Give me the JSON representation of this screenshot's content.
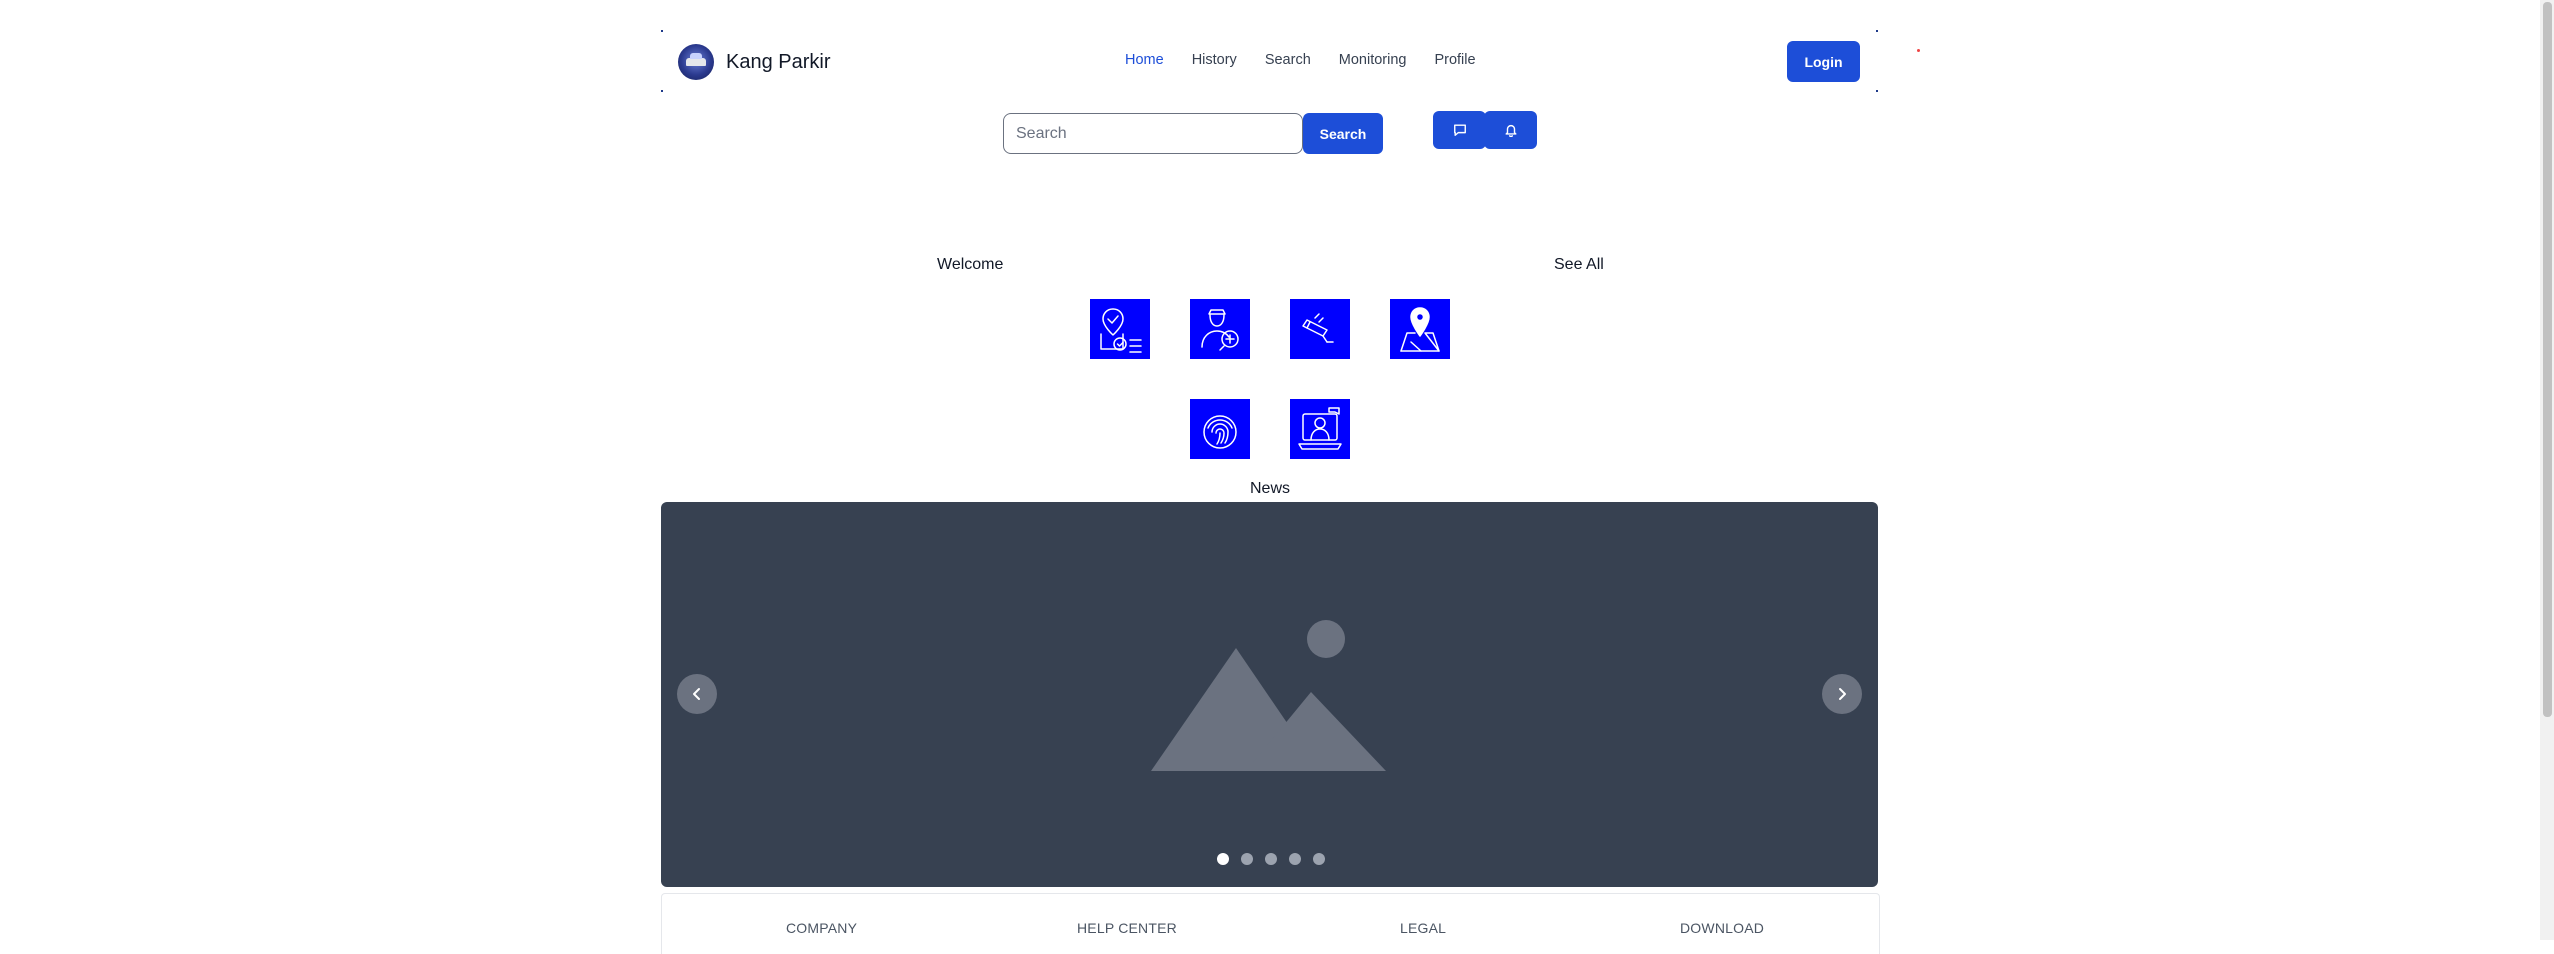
{
  "brand": {
    "name": "Kang Parkir",
    "logo_icon": "car-logo"
  },
  "nav": {
    "items": [
      {
        "label": "Home",
        "active": true
      },
      {
        "label": "History",
        "active": false
      },
      {
        "label": "Search",
        "active": false
      },
      {
        "label": "Monitoring",
        "active": false
      },
      {
        "label": "Profile",
        "active": false
      }
    ],
    "login_label": "Login"
  },
  "search": {
    "placeholder": "Search",
    "value": "",
    "button_label": "Search",
    "icon_buttons": [
      "chat-icon",
      "bell-icon"
    ]
  },
  "welcome": {
    "title": "Welcome",
    "see_all_label": "See All",
    "features": [
      {
        "icon": "location-checklist-icon"
      },
      {
        "icon": "parking-attendant-icon"
      },
      {
        "icon": "cctv-camera-icon"
      },
      {
        "icon": "map-pin-icon"
      },
      {
        "icon": "fingerprint-icon"
      },
      {
        "icon": "online-support-icon"
      }
    ]
  },
  "news": {
    "title": "News",
    "slide_image": "image-placeholder-icon",
    "slide_count": 5,
    "active_slide": 1
  },
  "footer": {
    "columns": [
      "COMPANY",
      "HELP CENTER",
      "LEGAL",
      "DOWNLOAD"
    ]
  },
  "colors": {
    "primary": "#1d4ed8",
    "tile": "#0000ff",
    "carousel_bg": "#374151",
    "active_nav": "#1d4ed8"
  }
}
